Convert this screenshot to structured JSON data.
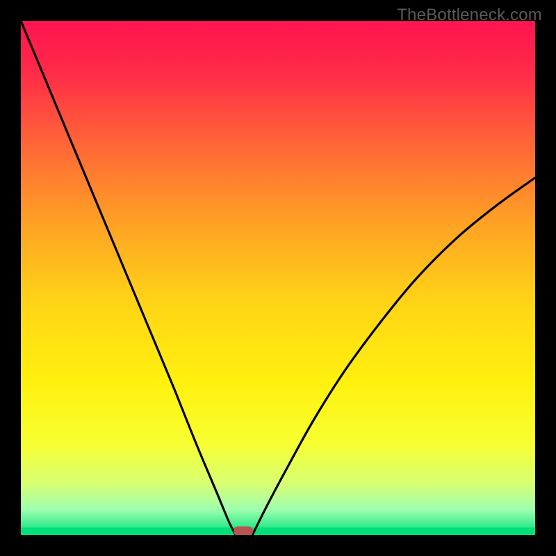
{
  "watermark": "TheBottleneck.com",
  "chart_data": {
    "type": "line",
    "title": "",
    "xlabel": "",
    "ylabel": "",
    "xlim": [
      0,
      1
    ],
    "ylim": [
      0,
      1
    ],
    "gradient_stops": [
      {
        "offset": 0.0,
        "color": "#ff1450"
      },
      {
        "offset": 0.1,
        "color": "#ff2b48"
      },
      {
        "offset": 0.25,
        "color": "#ff6a36"
      },
      {
        "offset": 0.4,
        "color": "#ffa424"
      },
      {
        "offset": 0.55,
        "color": "#ffd516"
      },
      {
        "offset": 0.7,
        "color": "#fff00e"
      },
      {
        "offset": 0.82,
        "color": "#f8ff30"
      },
      {
        "offset": 0.9,
        "color": "#d7ff73"
      },
      {
        "offset": 0.95,
        "color": "#9fffaf"
      },
      {
        "offset": 1.0,
        "color": "#00e07a"
      }
    ],
    "series": [
      {
        "name": "curve-left",
        "x": [
          0.0,
          0.05,
          0.1,
          0.15,
          0.2,
          0.25,
          0.3,
          0.34,
          0.38,
          0.405,
          0.418
        ],
        "values": [
          1.0,
          0.88,
          0.76,
          0.64,
          0.52,
          0.4,
          0.28,
          0.18,
          0.085,
          0.025,
          0.0
        ]
      },
      {
        "name": "curve-right",
        "x": [
          0.45,
          0.48,
          0.52,
          0.57,
          0.63,
          0.7,
          0.77,
          0.85,
          0.93,
          1.0
        ],
        "values": [
          0.0,
          0.06,
          0.135,
          0.225,
          0.32,
          0.415,
          0.5,
          0.58,
          0.645,
          0.695
        ]
      }
    ],
    "marker": {
      "x": 0.433,
      "y": 0.008,
      "color": "#b9534d"
    },
    "bottom_band_color": "#00e07a",
    "bottom_band_height": 0.015
  }
}
